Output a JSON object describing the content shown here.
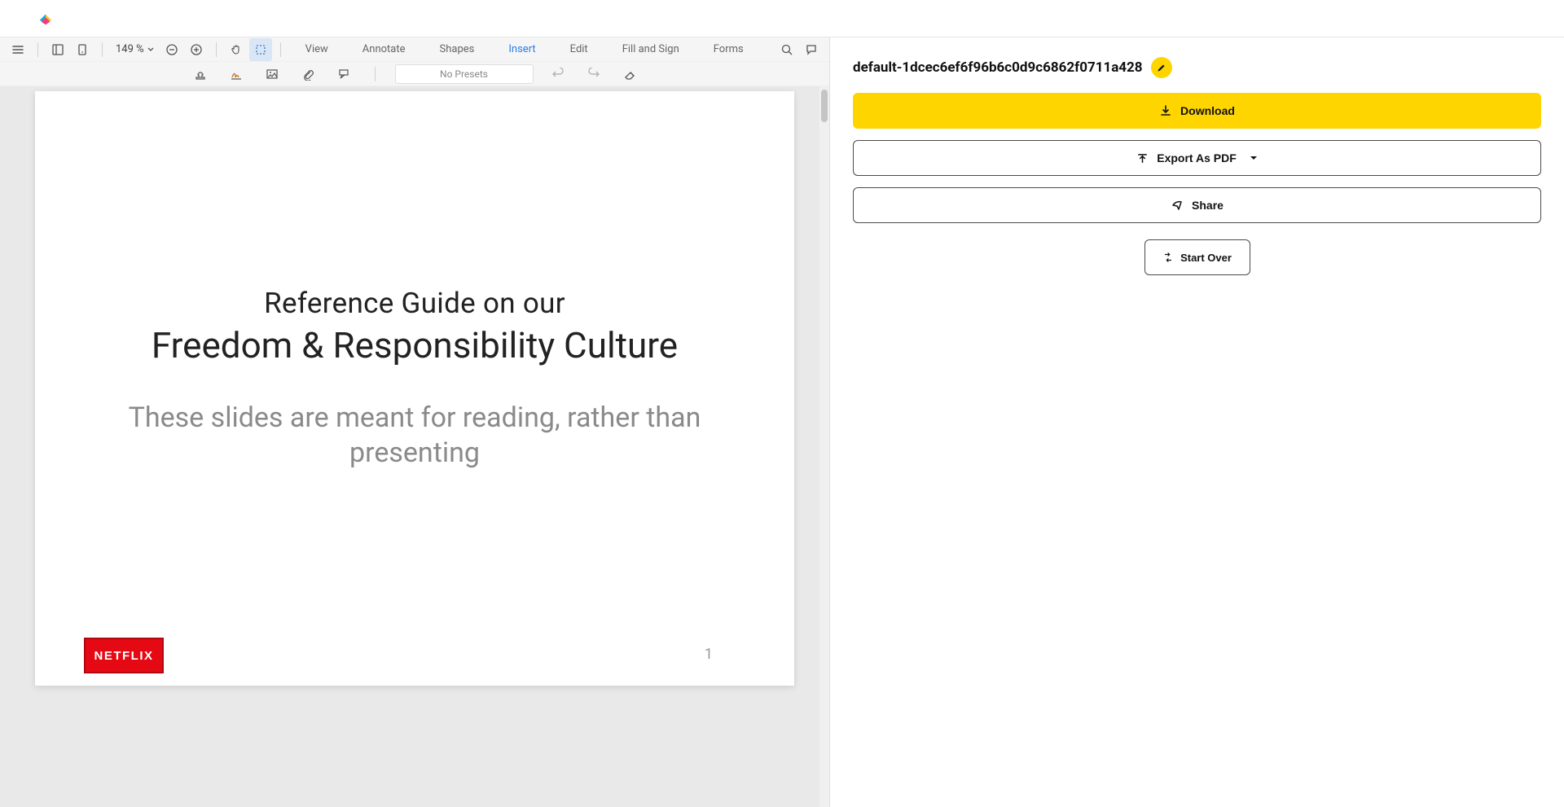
{
  "toolbar": {
    "zoom": "149 %",
    "tabs": [
      "View",
      "Annotate",
      "Shapes",
      "Insert",
      "Edit",
      "Fill and Sign",
      "Forms"
    ],
    "active_tab": "Insert",
    "presets_placeholder": "No Presets"
  },
  "document": {
    "subtitle": "Reference Guide on our",
    "title": "Freedom & Responsibility Culture",
    "note": "These slides are meant for reading, rather than presenting",
    "brand": "NETFLIX",
    "page_number": "1"
  },
  "sidebar": {
    "filename": "default-1dcec6ef6f96b6c0d9c6862f0711a428",
    "download_label": "Download",
    "export_label": "Export As PDF",
    "share_label": "Share",
    "startover_label": "Start Over"
  }
}
